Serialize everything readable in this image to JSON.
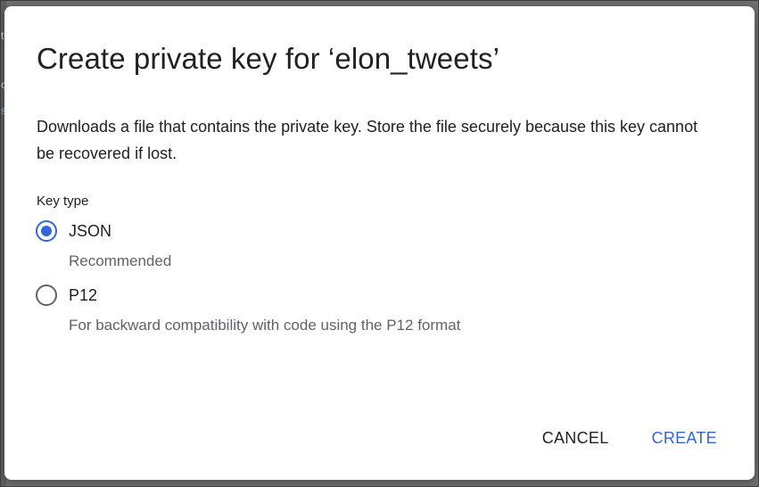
{
  "dialog": {
    "title": "Create private key for ‘elon_tweets’",
    "description": "Downloads a file that contains the private key. Store the file securely because this key cannot be recovered if lost.",
    "key_type_label": "Key type",
    "options": [
      {
        "label": "JSON",
        "hint": "Recommended",
        "selected": true
      },
      {
        "label": "P12",
        "hint": "For backward compatibility with code using the P12 format",
        "selected": false
      }
    ],
    "cancel_label": "CANCEL",
    "create_label": "CREATE"
  },
  "colors": {
    "accent": "#3367d6",
    "text_primary": "#202124",
    "text_secondary": "#5f6368",
    "backdrop": "#6f6f6f"
  }
}
